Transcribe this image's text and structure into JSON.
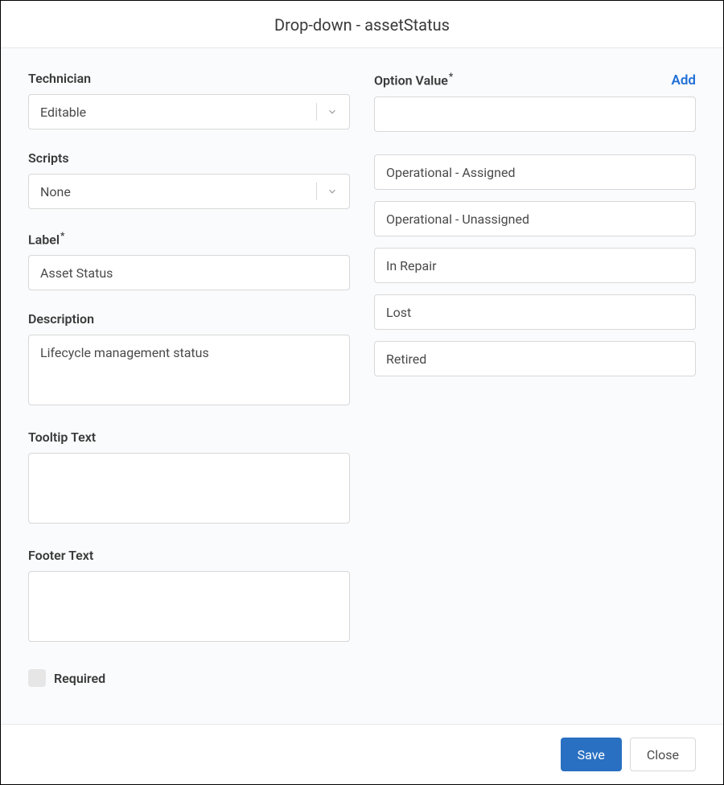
{
  "header": {
    "title": "Drop-down - assetStatus"
  },
  "left": {
    "technician": {
      "label": "Technician",
      "value": "Editable"
    },
    "scripts": {
      "label": "Scripts",
      "value": "None"
    },
    "labelField": {
      "label": "Label",
      "value": "Asset Status"
    },
    "description": {
      "label": "Description",
      "value": "Lifecycle management status"
    },
    "tooltip": {
      "label": "Tooltip Text",
      "value": ""
    },
    "footerText": {
      "label": "Footer Text",
      "value": ""
    },
    "required": {
      "label": "Required",
      "checked": false
    }
  },
  "right": {
    "optionValue": {
      "label": "Option Value",
      "addLabel": "Add",
      "inputValue": ""
    },
    "options": [
      "Operational - Assigned",
      "Operational - Unassigned",
      "In Repair",
      "Lost",
      "Retired"
    ]
  },
  "footer": {
    "save": "Save",
    "close": "Close"
  }
}
